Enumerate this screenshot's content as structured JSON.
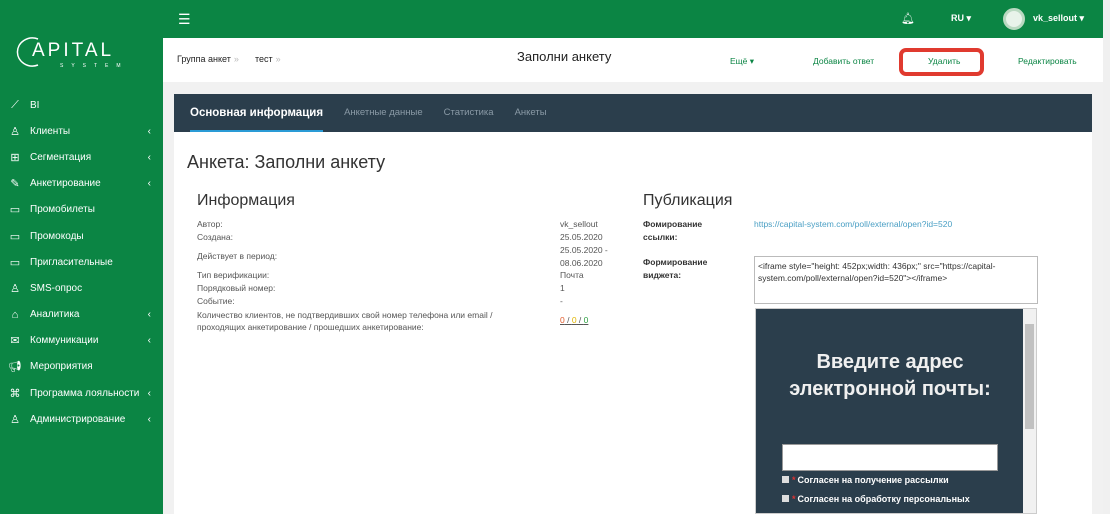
{
  "brand": {
    "logo": "CAPITAL",
    "logo_sub": "SYSTEM"
  },
  "sidebar": {
    "items": [
      {
        "label": "BI",
        "icon": "chart-line-icon",
        "chev": false
      },
      {
        "label": "Клиенты",
        "icon": "user-icon",
        "chev": true
      },
      {
        "label": "Сегментация",
        "icon": "sitemap-icon",
        "chev": true
      },
      {
        "label": "Анкетирование",
        "icon": "form-icon",
        "chev": true
      },
      {
        "label": "Промобилеты",
        "icon": "ticket-icon",
        "chev": false
      },
      {
        "label": "Промокоды",
        "icon": "ticket-icon",
        "chev": false
      },
      {
        "label": "Пригласительные",
        "icon": "ticket-icon",
        "chev": false
      },
      {
        "label": "SMS-опрос",
        "icon": "user-icon",
        "chev": false
      },
      {
        "label": "Аналитика",
        "icon": "building-icon",
        "chev": true
      },
      {
        "label": "Коммуникации",
        "icon": "envelope-icon",
        "chev": true
      },
      {
        "label": "Мероприятия",
        "icon": "megaphone-icon",
        "chev": false
      },
      {
        "label": "Программа лояльности",
        "icon": "gift-icon",
        "chev": true
      },
      {
        "label": "Администрирование",
        "icon": "user-icon",
        "chev": true
      }
    ]
  },
  "topbar": {
    "lang": "RU",
    "user": "vk_sellout"
  },
  "header": {
    "breadcrumb": [
      "Группа анкет",
      "тест"
    ],
    "title": "Заполни анкету",
    "more": "Ещё",
    "add_answer": "Добавить ответ",
    "delete": "Удалить",
    "edit": "Редактировать"
  },
  "tabs": [
    "Основная информация",
    "Анкетные данные",
    "Статистика",
    "Анкеты"
  ],
  "main": {
    "title": "Анкета: Заполни анкету",
    "info_title": "Информация",
    "info": [
      {
        "label": "Автор:",
        "value": "vk_sellout"
      },
      {
        "label": "Создана:",
        "value": "25.05.2020"
      },
      {
        "label": "Действует в период:",
        "value": "25.05.2020 - 08.06.2020"
      },
      {
        "label": "Тип верификации:",
        "value": "Почта"
      },
      {
        "label": "Порядковый номер:",
        "value": "1"
      },
      {
        "label": "Событие:",
        "value": "-"
      },
      {
        "label": "Количество клиентов, не подтвердивших свой номер телефона или email / проходящих анкетирование / прошедших анкетирование:",
        "value": ""
      }
    ],
    "counts": [
      "0",
      "0",
      "0"
    ],
    "count_colors": [
      "#e05a2b",
      "#e0b400",
      "#2ea043"
    ],
    "pub_title": "Публикация",
    "link_label": "Фомирование ссылки:",
    "link": "https://capital-system.com/poll/external/open?id=520",
    "widget_label": "Формирование виджета:",
    "widget_code": "<iframe style=\"height: 452px;width: 436px;\" src=\"https://capital-system.com/poll/external/open?id=520\"></iframe>",
    "widget": {
      "title": "Введите адрес электронной почты:",
      "consent1": "Согласен на получение рассылки",
      "consent2": "Согласен на обработку персональных"
    }
  }
}
